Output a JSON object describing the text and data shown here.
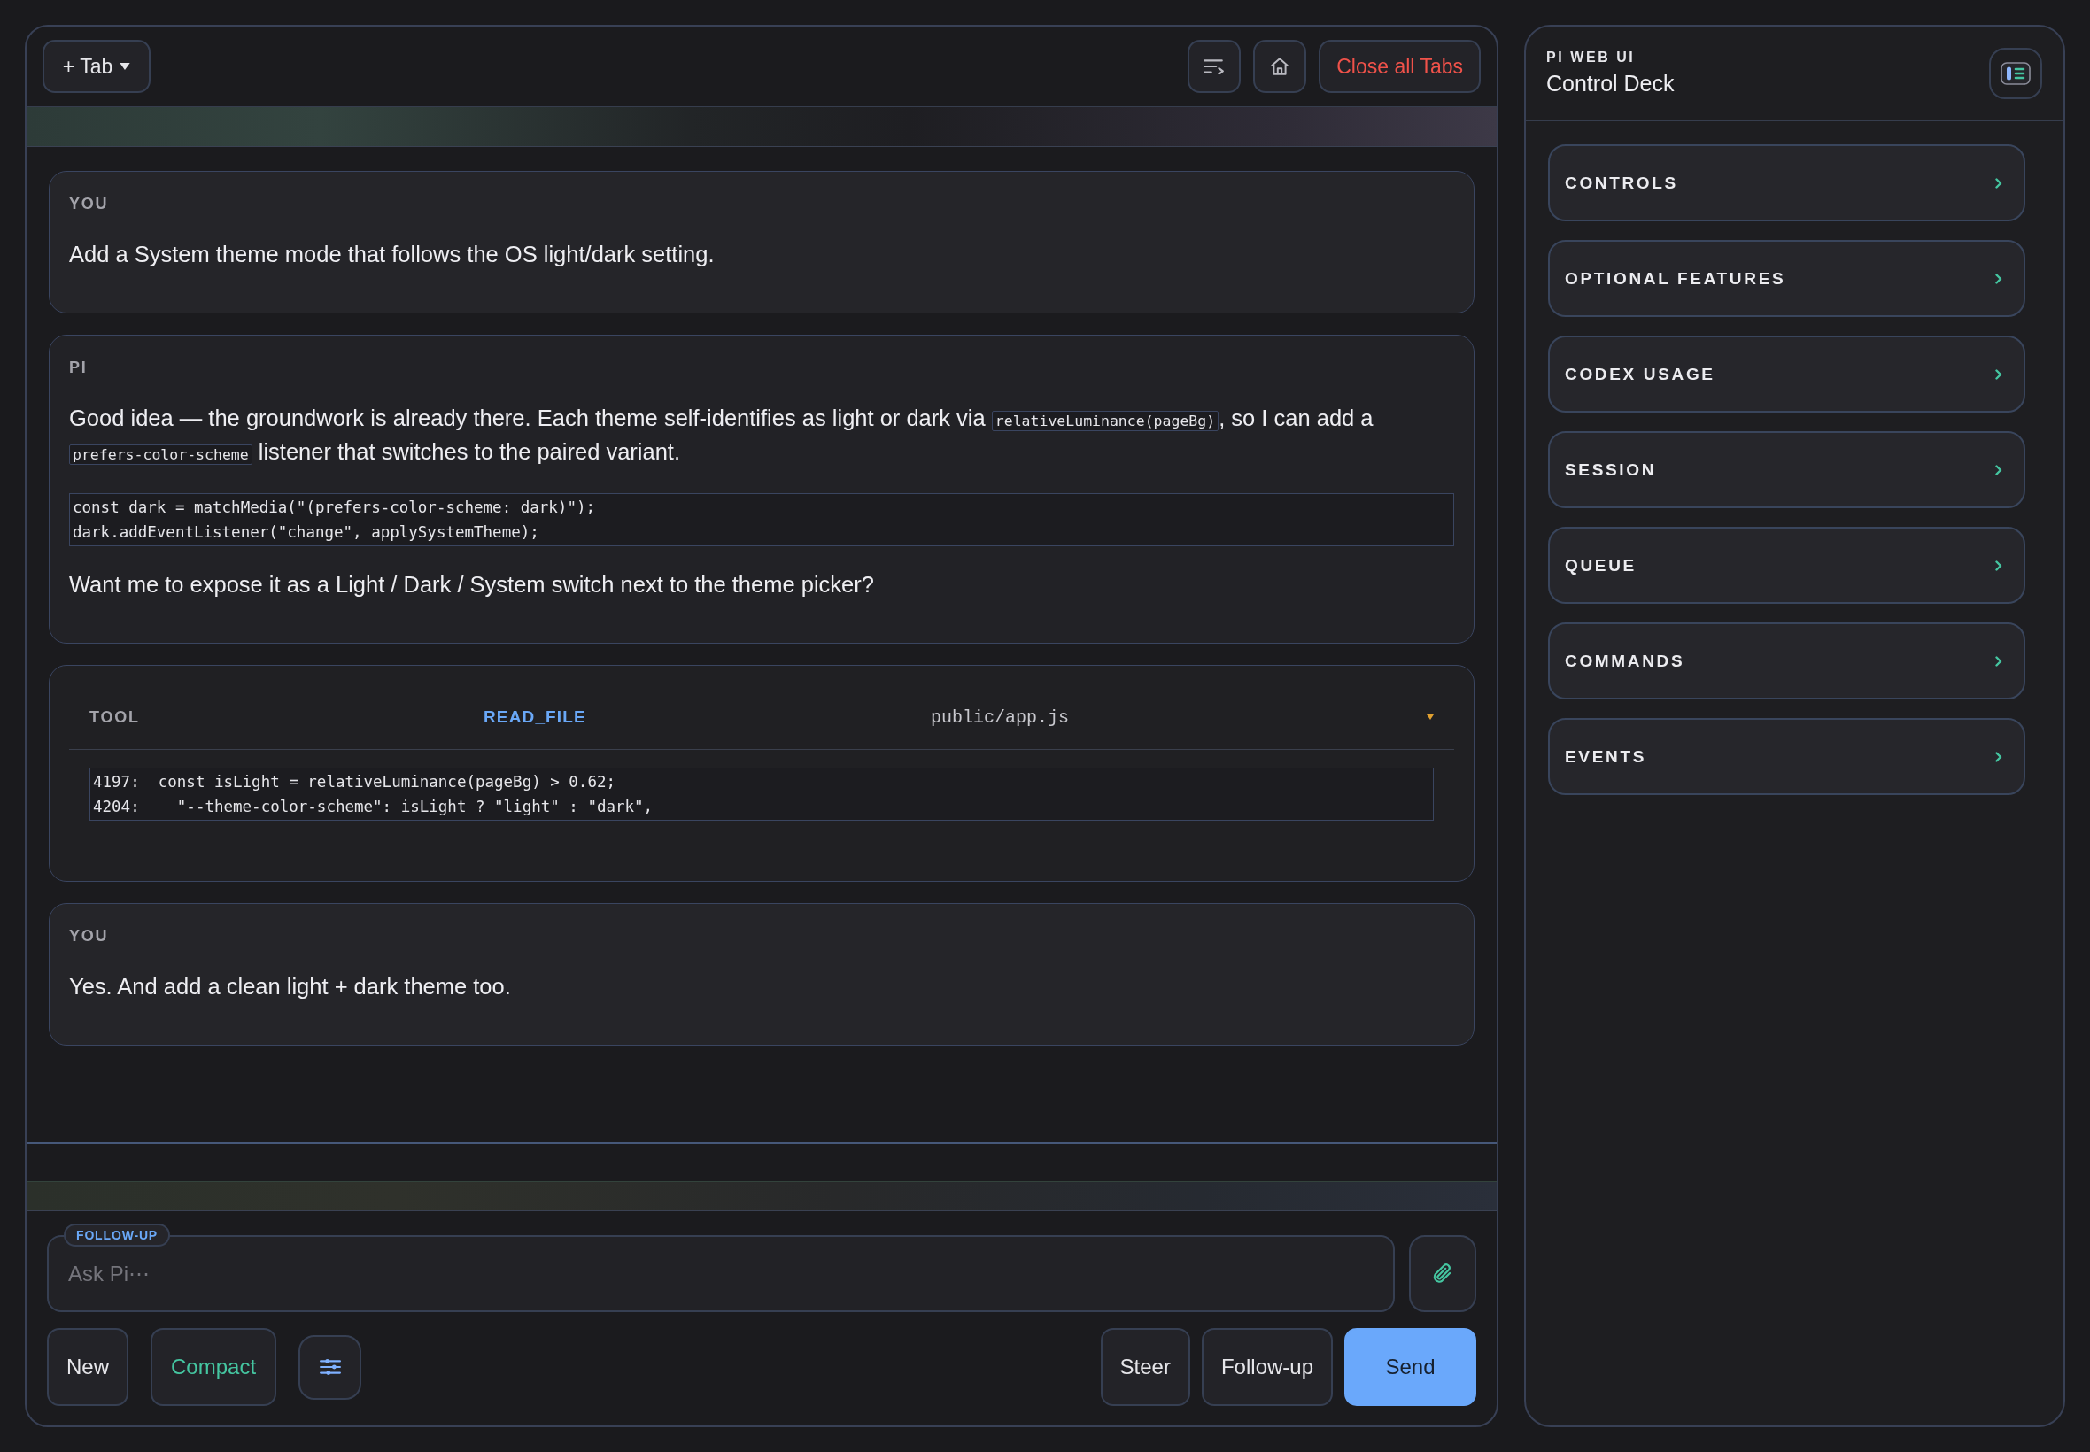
{
  "tab_bar": {
    "new_tab_button": "+ Tab",
    "close_all_button": "Close all Tabs"
  },
  "messages": [
    {
      "kind": "user",
      "role": "YOU",
      "blocks": [
        {
          "kind": "paragraph",
          "segments": [
            {
              "kind": "text",
              "text": "Add a System theme mode that follows the OS light/dark setting."
            }
          ]
        }
      ]
    },
    {
      "kind": "assistant",
      "role": "PI",
      "blocks": [
        {
          "kind": "paragraph",
          "segments": [
            {
              "kind": "text",
              "text": "Good idea — the groundwork is already there. Each theme self-identifies as light or dark via "
            },
            {
              "kind": "code",
              "text": "relativeLuminance(pageBg)"
            },
            {
              "kind": "text",
              "text": ", so I can add a "
            },
            {
              "kind": "code",
              "text": "prefers-color-scheme"
            },
            {
              "kind": "text",
              "text": " listener that switches to the paired variant."
            }
          ]
        },
        {
          "kind": "code",
          "lines": [
            "const dark = matchMedia(\"(prefers-color-scheme: dark)\");",
            "dark.addEventListener(\"change\", applySystemTheme);"
          ]
        },
        {
          "kind": "paragraph",
          "segments": [
            {
              "kind": "text",
              "text": "Want me to expose it as a Light / Dark / System switch next to the theme picker?"
            }
          ]
        }
      ]
    },
    {
      "kind": "tool",
      "role": "TOOL",
      "tool": "READ_FILE",
      "path": "public/app.js",
      "expanded": true,
      "output": [
        "4197:  const isLight = relativeLuminance(pageBg) > 0.62;",
        "4204:    \"--theme-color-scheme\": isLight ? \"light\" : \"dark\","
      ]
    },
    {
      "kind": "user",
      "role": "YOU",
      "blocks": [
        {
          "kind": "paragraph",
          "segments": [
            {
              "kind": "text",
              "text": "Yes. And add a clean light + dark theme too."
            }
          ]
        }
      ]
    }
  ],
  "composer": {
    "mode_badge": "FOLLOW-UP",
    "input": {
      "placeholder": "Ask Pi⋯"
    },
    "left_actions": [
      {
        "label": "New",
        "kind": "plain"
      },
      {
        "label": "Compact",
        "kind": "accent"
      }
    ],
    "right_actions": [
      {
        "label": "Steer",
        "kind": "plain"
      },
      {
        "label": "Follow-up",
        "kind": "plain"
      },
      {
        "label": "Send",
        "kind": "primary"
      }
    ]
  },
  "sidebar": {
    "eyebrow": "PI WEB UI",
    "title": "Control Deck",
    "sections": [
      {
        "label": "CONTROLS",
        "expanded": false
      },
      {
        "label": "OPTIONAL FEATURES",
        "expanded": false
      },
      {
        "label": "CODEX USAGE",
        "expanded": false
      },
      {
        "label": "SESSION",
        "expanded": false
      },
      {
        "label": "QUEUE",
        "expanded": false
      },
      {
        "label": "COMMANDS",
        "expanded": false
      },
      {
        "label": "EVENTS",
        "expanded": false
      }
    ]
  }
}
